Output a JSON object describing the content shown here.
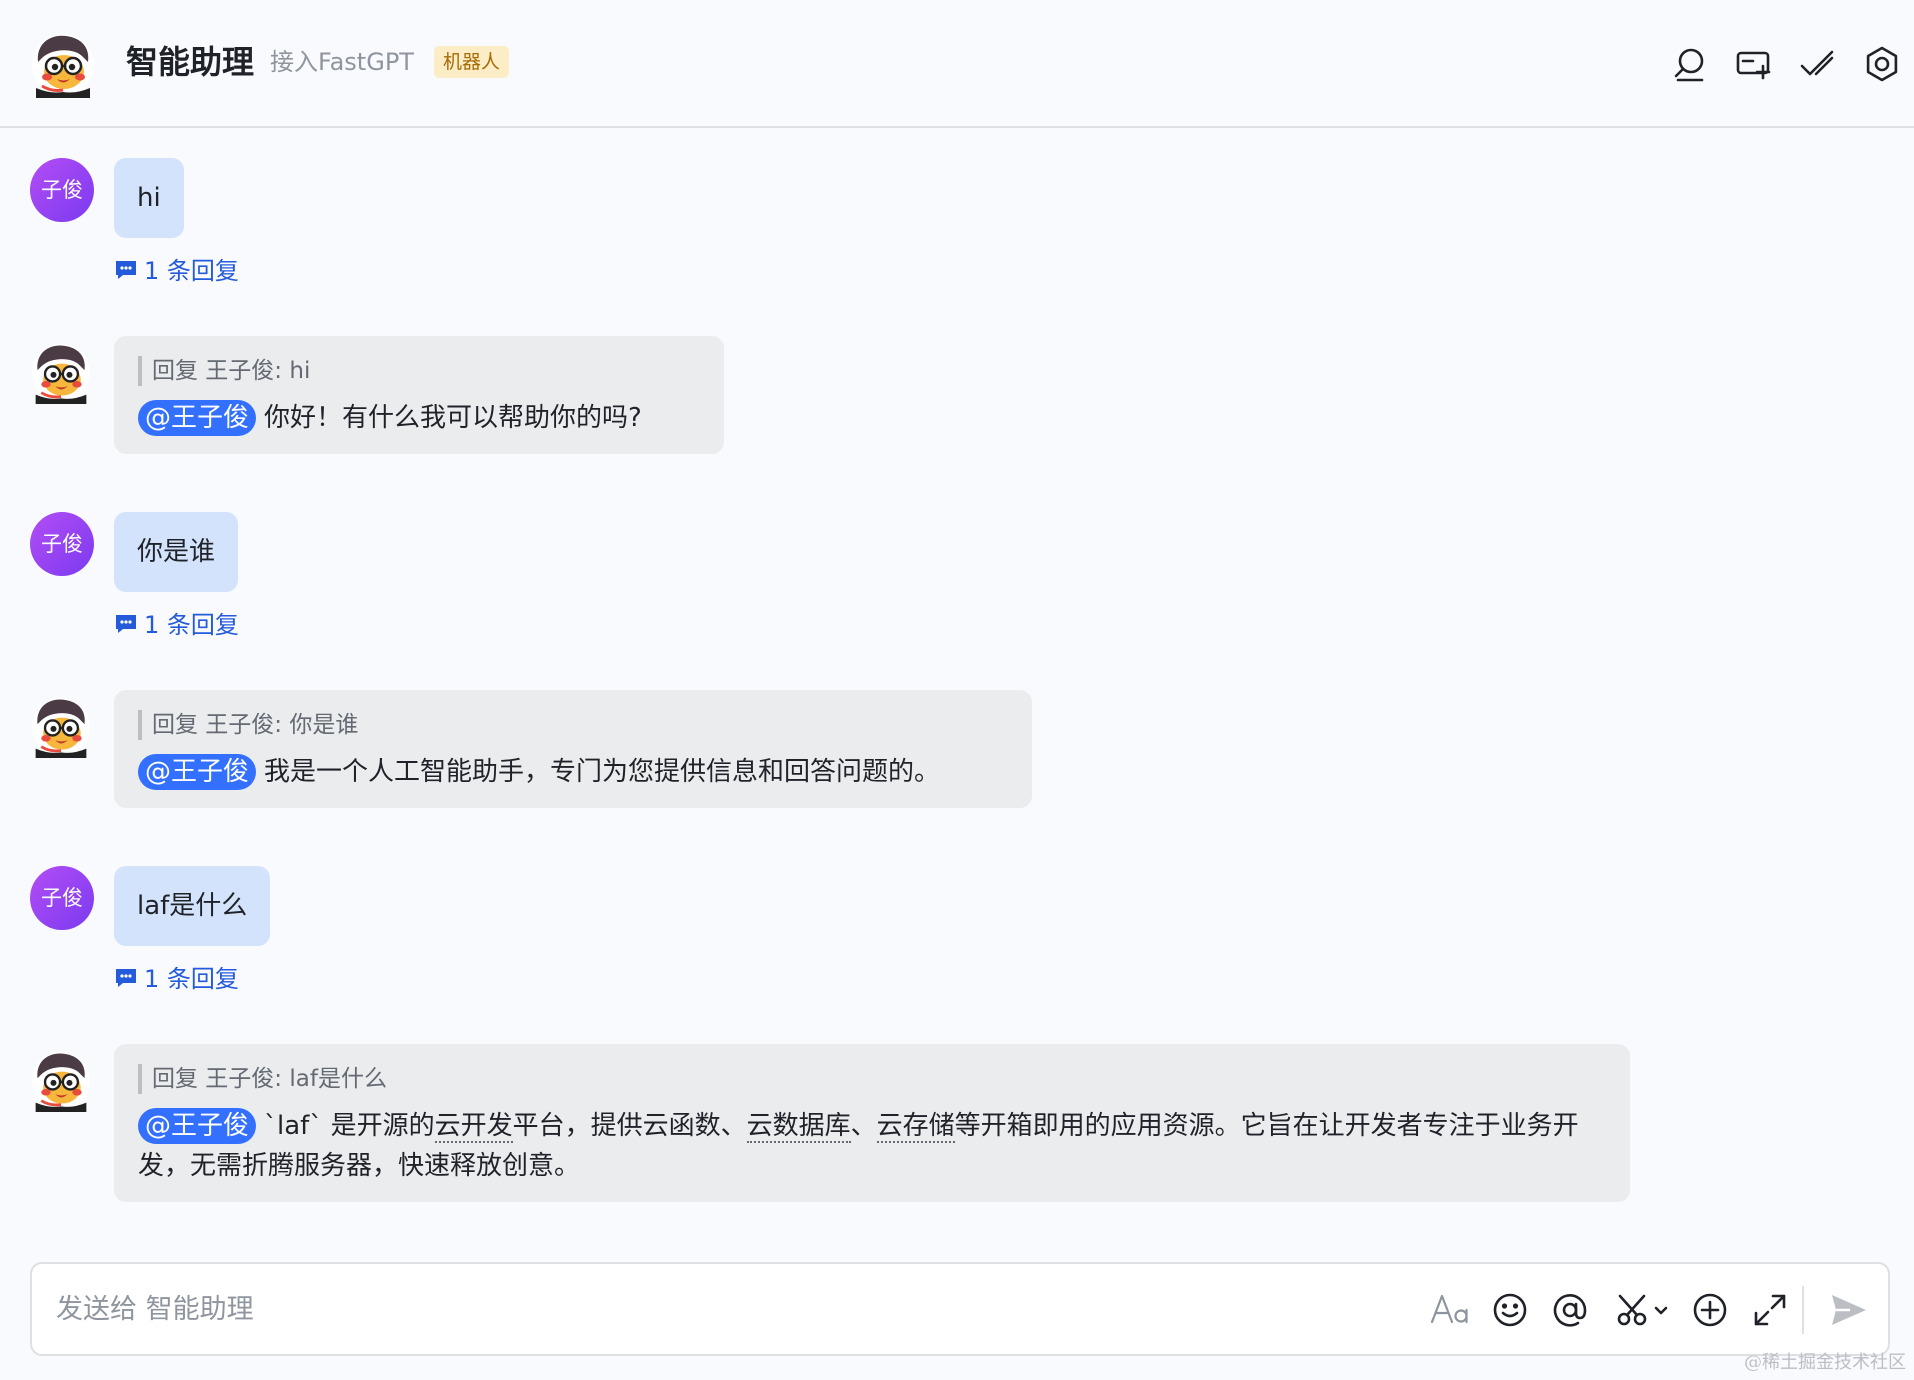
{
  "header": {
    "title": "智能助理",
    "subtitle": "接入FastGPT",
    "badge": "机器人",
    "tools": [
      "search-icon",
      "add-tab-icon",
      "check-done-icon",
      "settings-icon"
    ]
  },
  "messages": [
    {
      "type": "user",
      "avatar_text": "子俊",
      "text": "hi",
      "reply_count": "1 条回复"
    },
    {
      "type": "bot",
      "quote": "回复 王子俊: hi",
      "mention": "@王子俊",
      "text": "你好！有什么我可以帮助你的吗?"
    },
    {
      "type": "user",
      "avatar_text": "子俊",
      "text": "你是谁",
      "reply_count": "1 条回复"
    },
    {
      "type": "bot",
      "quote": "回复 王子俊: 你是谁",
      "mention": "@王子俊",
      "text": "我是一个人工智能助手，专门为您提供信息和回答问题的。"
    },
    {
      "type": "user",
      "avatar_text": "子俊",
      "text": "laf是什么",
      "reply_count": "1 条回复"
    },
    {
      "type": "bot",
      "quote": "回复 王子俊: laf是什么",
      "mention": "@王子俊",
      "segments": [
        "`laf` 是开源的",
        "云开发",
        "平台，提供云函数、",
        "云数据库",
        "、",
        "云存储",
        "等开箱即用的应用资源。它旨在让开发者专注于业务开发，无需折腾服务器，快速释放创意。"
      ]
    }
  ],
  "composer": {
    "placeholder": "发送给 智能助理",
    "tools": [
      "text-format-icon",
      "emoji-icon",
      "mention-icon",
      "scissors-icon",
      "add-icon",
      "expand-icon",
      "send-icon"
    ]
  },
  "watermark": "@稀土掘金技术社区",
  "colors": {
    "accent": "#3370ff",
    "user_bubble": "#d4e3fc",
    "bot_bubble": "#ebecee",
    "link": "#245bdb",
    "badge_bg": "#fcedc6",
    "badge_text": "#a56b06"
  }
}
